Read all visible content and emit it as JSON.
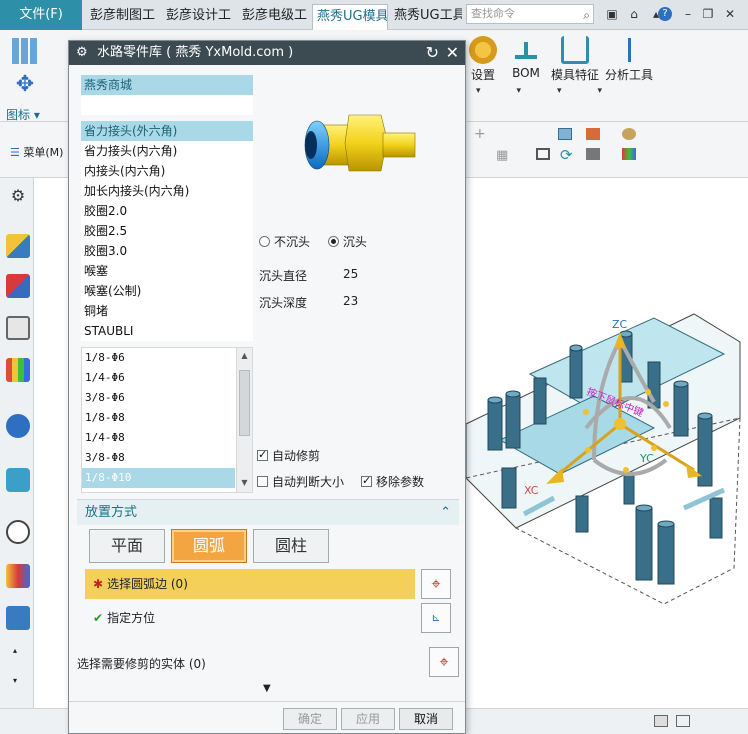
{
  "topbar": {
    "file": "文件(F)",
    "tabs": [
      "彭彦制图工",
      "彭彦设计工",
      "彭彦电级工",
      "燕秀UG模具",
      "燕秀UG工具"
    ],
    "active_tab_index": 3,
    "search_placeholder": "查找命令"
  },
  "ribbon": {
    "icon_group": "图标",
    "menu": "菜单(M)",
    "buttons": [
      {
        "label": "设置",
        "icon": "gear-icon"
      },
      {
        "label": "BOM",
        "icon": "bom-icon"
      },
      {
        "label": "模具特征",
        "icon": "mold-feature-icon"
      },
      {
        "label": "分析工具",
        "icon": "analysis-icon"
      }
    ]
  },
  "dialog": {
    "title": "水路零件库 ( 燕秀 YxMold.com )",
    "shop_header": "燕秀商城",
    "categories": [
      "省力接头(外六角)",
      "省力接头(内六角)",
      "内接头(内六角)",
      "加长内接头(内六角)",
      "胶圈2.0",
      "胶圈2.5",
      "胶圈3.0",
      "喉塞",
      "喉塞(公制)",
      "铜堵",
      "STAUBLI"
    ],
    "selected_category_index": 0,
    "sizes": [
      "1/8-Φ6",
      "1/4-Φ6",
      "3/8-Φ6",
      "1/8-Φ8",
      "1/4-Φ8",
      "3/8-Φ8",
      "1/8-Φ10"
    ],
    "selected_size_index": 6,
    "radio_no_counterbore": "不沉头",
    "radio_counterbore": "沉头",
    "counterbore_selected": true,
    "counterbore_diameter_label": "沉头直径",
    "counterbore_diameter_value": "25",
    "counterbore_depth_label": "沉头深度",
    "counterbore_depth_value": "23",
    "auto_trim_label": "自动修剪",
    "auto_trim_checked": true,
    "auto_size_label": "自动判断大小",
    "auto_size_checked": false,
    "remove_params_label": "移除参数",
    "remove_params_checked": true,
    "placement_header": "放置方式",
    "placement_options": [
      "平面",
      "圆弧",
      "圆柱"
    ],
    "placement_selected_index": 1,
    "select_arc_label": "选择圆弧边 (0)",
    "orientation_label": "指定方位",
    "trim_body_label": "选择需要修剪的实体 (0)",
    "ok_label": "确定",
    "apply_label": "应用",
    "cancel_label": "取消"
  },
  "viewport": {
    "axis_z": "ZC",
    "axis_y": "YC",
    "axis_x": "XC",
    "manip_label": "按下鼠标中键"
  },
  "colors": {
    "accent": "#2d8fa8",
    "selection": "#a9d8e6",
    "active_option": "#f2a541",
    "select_row": "#f4cf5a"
  }
}
